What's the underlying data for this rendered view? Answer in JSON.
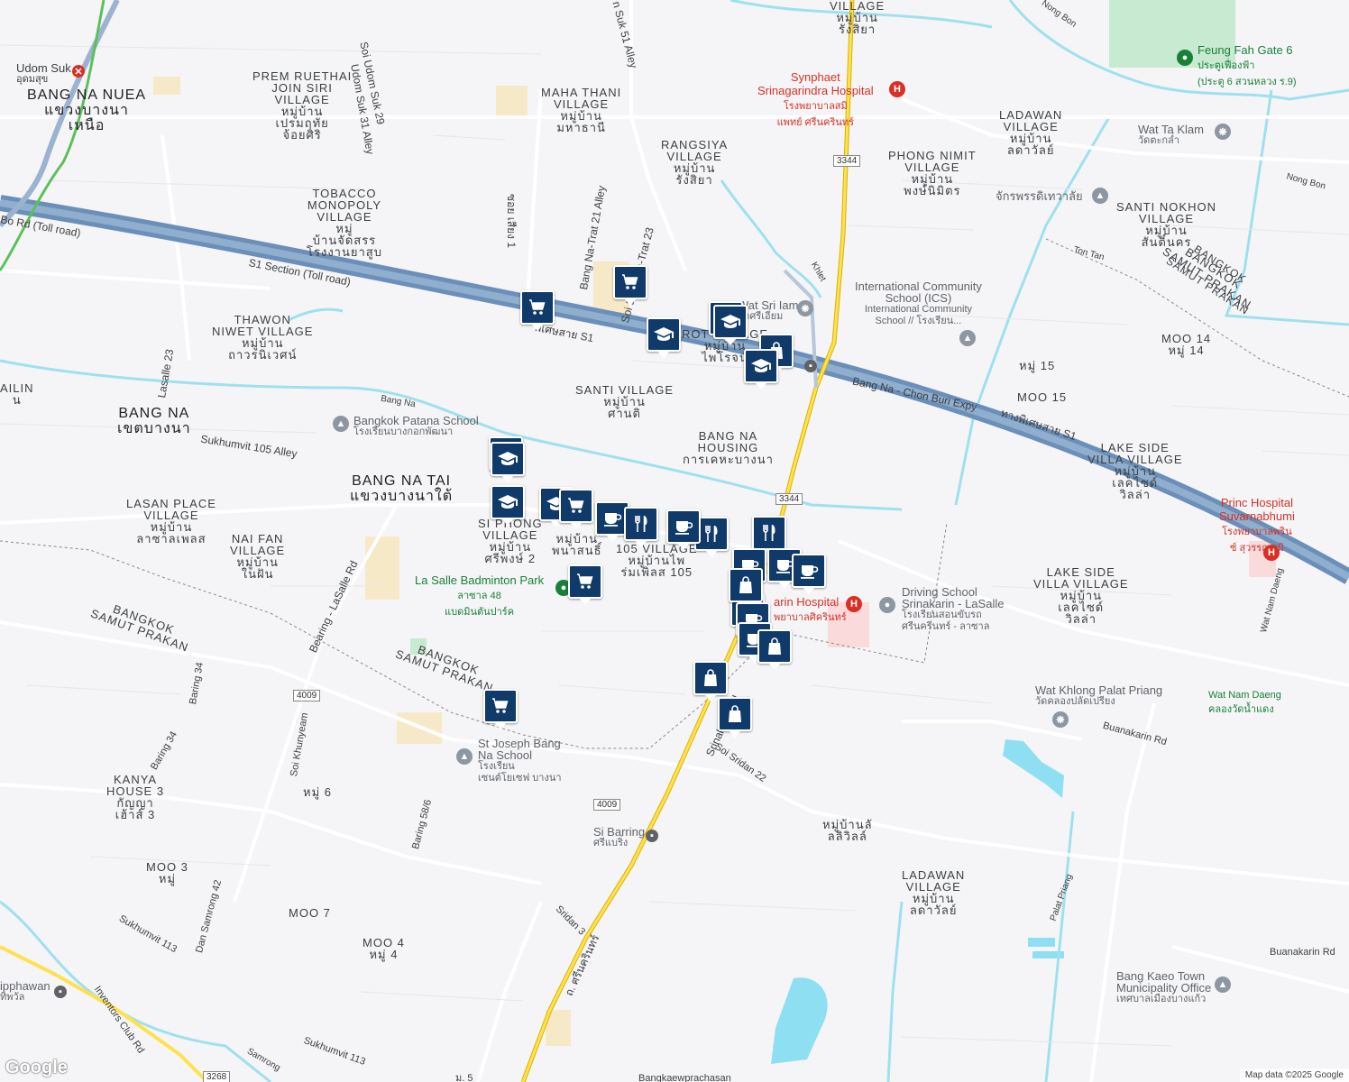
{
  "map": {
    "attribution": "Map data ©2025 Google",
    "logo": "Google",
    "districts": [
      {
        "name": "bang-na-nuea",
        "lines": [
          "BANG NA NUEA",
          "แขวงบางนา",
          "เหนือ"
        ]
      },
      {
        "name": "bang-na",
        "lines": [
          "BANG NA",
          "เขตบางนา"
        ]
      },
      {
        "name": "bang-na-tai",
        "lines": [
          "BANG NA TAI",
          "แขวงบางนาใต้"
        ]
      }
    ],
    "areas": [
      {
        "name": "prem-ruethai",
        "lines": [
          "PREM RUETHAI",
          "JOIN SIRI",
          "VILLAGE",
          "หมู่บ้าน",
          "เปรมฤทัย",
          "จ้อยศิริ"
        ]
      },
      {
        "name": "maha-thani",
        "lines": [
          "MAHA THANI",
          "VILLAGE",
          "หมู่บ้าน",
          "มหาธานี"
        ]
      },
      {
        "name": "rangsiya",
        "lines": [
          "RANGSIYA",
          "VILLAGE",
          "หมู่บ้าน",
          "รังสิยา"
        ]
      },
      {
        "name": "rangsiya-top",
        "lines": [
          "VILLAGE",
          "หมู่บ้าน",
          "รังสิยา"
        ]
      },
      {
        "name": "tobacco",
        "lines": [
          "TOBACCO",
          "MONOPOLY",
          "VILLAGE",
          "หมู่",
          "บ้านจัดสรร",
          "โรงงานยาสูบ"
        ]
      },
      {
        "name": "thawon",
        "lines": [
          "THAWON",
          "NIWET VILLAGE",
          "หมู่บ้าน",
          "ถาวรนิเวศน์"
        ]
      },
      {
        "name": "ladawan-1",
        "lines": [
          "LADAWAN",
          "VILLAGE",
          "หมู่บ้าน",
          "ลดาวัลย์"
        ]
      },
      {
        "name": "phong-nimit",
        "lines": [
          "PHONG NIMIT",
          "VILLAGE",
          "หมู่บ้าน",
          "พงษ์นิมิตร"
        ]
      },
      {
        "name": "santi-nokhon",
        "lines": [
          "SANTI NOKHON",
          "VILLAGE",
          "หมู่บ้าน",
          "สันติ์นคร"
        ]
      },
      {
        "name": "santi",
        "lines": [
          "SANTI VILLAGE",
          "หมู่บ้าน",
          "ศานติ"
        ]
      },
      {
        "name": "bang-na-housing",
        "lines": [
          "BANG NA",
          "HOUSING",
          "การเคหะบางนา"
        ]
      },
      {
        "name": "rot-village",
        "lines": [
          "ROT VILLAGE",
          "หมู่บ้าน",
          "ไพโรจน์"
        ]
      },
      {
        "name": "lasan-place",
        "lines": [
          "LASAN PLACE",
          "VILLAGE",
          "หมู่บ้าน",
          "ลาซาลเพลส"
        ]
      },
      {
        "name": "nai-fan",
        "lines": [
          "NAI FAN",
          "VILLAGE",
          "หมู่บ้าน",
          "ในฝัน"
        ]
      },
      {
        "name": "si-phong",
        "lines": [
          "SI PHONG",
          "VILLAGE",
          "หมู่บ้าน",
          "ศรีพงษ์ 2"
        ]
      },
      {
        "name": "phanasan",
        "lines": [
          "หมู่บ้าน",
          "พนาสนธิ์"
        ]
      },
      {
        "name": "village-105",
        "lines": [
          "105 VILLAGE",
          "หมู่บ้านไพ",
          "ร่มเพิ่ลส 105"
        ]
      },
      {
        "name": "lake-side-1",
        "lines": [
          "LAKE SIDE",
          "VILLA VILLAGE",
          "หมู่บ้าน",
          "เลคไซด์",
          "วิลล่า"
        ]
      },
      {
        "name": "lake-side-2",
        "lines": [
          "LAKE SIDE",
          "VILLA VILLAGE",
          "หมู่บ้าน",
          "เลคไซด์",
          "วิลล่า"
        ]
      },
      {
        "name": "kanya-house",
        "lines": [
          "KANYA",
          "HOUSE 3",
          "กัญญา",
          "เฮ้าส์ 3"
        ]
      },
      {
        "name": "ladawan-2",
        "lines": [
          "LADAWAN",
          "VILLAGE",
          "หมู่บ้าน",
          "ลดาวัลย์"
        ]
      },
      {
        "name": "lalil-villa",
        "lines": [
          "หมู่บ้านลั",
          "ลลิวิลล์"
        ]
      },
      {
        "name": "moo-14",
        "lines": [
          "MOO 14",
          "หมู่ 14"
        ]
      },
      {
        "name": "moo-15a",
        "lines": [
          "หมู่ 15"
        ]
      },
      {
        "name": "moo-15b",
        "lines": [
          "MOO 15"
        ]
      },
      {
        "name": "moo-6",
        "lines": [
          "หมู่ 6"
        ]
      },
      {
        "name": "moo-3",
        "lines": [
          "MOO 3",
          "หมู่"
        ]
      },
      {
        "name": "moo-7",
        "lines": [
          "MOO 7"
        ]
      },
      {
        "name": "moo-4",
        "lines": [
          "MOO 4",
          "หมู่ 4"
        ]
      },
      {
        "name": "bangkok-1",
        "lines": [
          "BANGKOK",
          "SAMUT PRAKAN"
        ]
      },
      {
        "name": "bangkok-2",
        "lines": [
          "BANGKOK",
          "SAMUT PRAKAN"
        ]
      },
      {
        "name": "bangkok-3",
        "lines": [
          "BANGKOK",
          "SAMUT PRAKAN"
        ]
      },
      {
        "name": "ailin",
        "lines": [
          "AILIN",
          "น"
        ]
      }
    ],
    "pois": [
      {
        "name": "udom-suk",
        "text": [
          "Udom Suk",
          "อุดมสุข"
        ],
        "style": "poi"
      },
      {
        "name": "synphaet",
        "text": [
          "Synphaet",
          "Srinagarindra Hospital",
          "โรงพยาบาลสมิ",
          "แพทย์ ศรีนครินทร์"
        ],
        "style": "poi-red"
      },
      {
        "name": "feung-fah",
        "text": [
          "Feung Fah Gate 6",
          "ประตูเฟื่องฟ้า",
          "(ประตู 6 สวนหลวง ร.9)"
        ],
        "style": "poi-green"
      },
      {
        "name": "wat-ta-klam",
        "text": [
          "Wat Ta Klam",
          "วัดตะกล่ำ"
        ],
        "style": "poi"
      },
      {
        "name": "chakkraphat",
        "text": [
          "จักรพรรดิเทวาลัย"
        ],
        "style": "poi"
      },
      {
        "name": "ics",
        "text": [
          "International Community",
          "School (ICS)",
          "International Community",
          "School // โรงเรียน..."
        ],
        "style": "poi"
      },
      {
        "name": "wat-sri-iam",
        "text": [
          "Wat Sri Iam",
          "วัดศรีเอี่ยม"
        ],
        "style": "poi"
      },
      {
        "name": "patana",
        "text": [
          "Bangkok Patana School",
          "โรงเรียนบางกอกพัฒนา"
        ],
        "style": "poi"
      },
      {
        "name": "la-salle-park",
        "text": [
          "La Salle Badminton Park",
          "ลาซาล 48",
          "แบดมินตันปาร์ค"
        ],
        "style": "poi-green"
      },
      {
        "name": "srinakarin-hospital",
        "text": [
          "arin Hospital",
          "พยาบาลศิครินทร์"
        ],
        "style": "poi-red"
      },
      {
        "name": "driving-school",
        "text": [
          "Driving School",
          "Srinakarin - LaSalle",
          "โรงเรียนสอนขับรถ",
          "ศรีนครินทร์ - ลาซาล"
        ],
        "style": "poi"
      },
      {
        "name": "princ-hospital",
        "text": [
          "Princ Hospital",
          "Suvarnabhumi",
          "โรงพยาบาลพริน",
          "ซ์ สุวรรณภูมิ"
        ],
        "style": "poi-red"
      },
      {
        "name": "wat-khlong",
        "text": [
          "Wat Khlong Palat Priang",
          "วัดคลองปลัดเปรียง"
        ],
        "style": "poi"
      },
      {
        "name": "wat-nam-daeng",
        "text": [
          "Wat Nam Daeng",
          "คลองวัดน้ำแดง"
        ],
        "style": "poi-green"
      },
      {
        "name": "st-joseph",
        "text": [
          "St Joseph Bang",
          "Na School",
          "โรงเรียน",
          "เซนต์โยเซฟ บางนา"
        ],
        "style": "poi"
      },
      {
        "name": "si-barring",
        "text": [
          "Si Barring",
          "ศรีแบริ่ง"
        ],
        "style": "poi"
      },
      {
        "name": "bang-kaeo",
        "text": [
          "Bang Kaeo Town",
          "Municipality Office",
          "เทศบาลเมืองบางแก้ว"
        ],
        "style": "poi"
      },
      {
        "name": "sipphawan",
        "text": [
          "ipphawan",
          "ทิพวัล"
        ],
        "style": "poi"
      }
    ],
    "roads": [
      {
        "name": "udom-suk-31",
        "text": "Udom Suk 31 Alley"
      },
      {
        "name": "soi-udom-suk-29",
        "text": "Soi Udom Suk 29"
      },
      {
        "name": "suk-51",
        "text": "n Suk 51 Alley"
      },
      {
        "name": "toll-road-1",
        "text": "Bo Rd (Toll road)"
      },
      {
        "name": "s1-section",
        "text": "S1 Section (Toll road)"
      },
      {
        "name": "s1-thai",
        "text": "พิเศษสาย S1"
      },
      {
        "name": "soi-lasalle-1",
        "text": "ซอย เสียง 1"
      },
      {
        "name": "bang-na-trat-21",
        "text": "Bang Na-Trat 21 Alley"
      },
      {
        "name": "soi-bangna-23",
        "text": "Soi Bang Na-Trat 23"
      },
      {
        "name": "lasalle-23",
        "text": "Lasalle 23"
      },
      {
        "name": "bang-na-canal",
        "text": "Bang Na"
      },
      {
        "name": "sukhumvit-105",
        "text": "Sukhumvit 105 Alley"
      },
      {
        "name": "bang-na-chon-buri",
        "text": "Bang Na - Chon Buri Expy"
      },
      {
        "name": "expy-thai",
        "text": "ทางพิเศษสาย S1"
      },
      {
        "name": "bearing-lasalle",
        "text": "Bearing - LaSalle Rd"
      },
      {
        "name": "baring-34a",
        "text": "Baring 34"
      },
      {
        "name": "baring-34b",
        "text": "Baring 34"
      },
      {
        "name": "soi-khunyeam",
        "text": "Soi Khunyeam"
      },
      {
        "name": "baring-58",
        "text": "Baring 58/6"
      },
      {
        "name": "srinakarin-rd",
        "text": "Srinakarin Rd"
      },
      {
        "name": "soi-sridan-22",
        "text": "Soi Sridan 22"
      },
      {
        "name": "sridan-3",
        "text": "Sridan 3"
      },
      {
        "name": "srinakarin-thai",
        "text": "ถ. ศรีนครินทร์"
      },
      {
        "name": "dan-samrong",
        "text": "Dan Samrong 42"
      },
      {
        "name": "sukhumvit-113a",
        "text": "Sukhumvit 113"
      },
      {
        "name": "sukhumvit-113b",
        "text": "Sukhumvit 113"
      },
      {
        "name": "inventors-club",
        "text": "Inventors Club Rd"
      },
      {
        "name": "samrong",
        "text": "Samrong"
      },
      {
        "name": "buanakarin-1",
        "text": "Buanakarin Rd"
      },
      {
        "name": "buanakarin-2",
        "text": "Buanakarin Rd"
      },
      {
        "name": "palat-priang",
        "text": "Palat Priang"
      },
      {
        "name": "nong-bon-1",
        "text": "Nong Bon"
      },
      {
        "name": "nong-bon-2",
        "text": "Nong Bon"
      },
      {
        "name": "ton-tan",
        "text": "Ton Tan"
      },
      {
        "name": "khlet",
        "text": "Khlet"
      },
      {
        "name": "wat-nam-daeng-rd",
        "text": "Wat Nam Daeng"
      },
      {
        "name": "bangkok-samut",
        "text": "BANGKOK"
      },
      {
        "name": "samut-prakan",
        "text": "SAMUT PRAKAN"
      },
      {
        "name": "moo-5",
        "text": "ม. 5"
      },
      {
        "name": "bangkaew",
        "text": "Bangkaewprachasan"
      }
    ],
    "badges": [
      {
        "name": "badge-3344-top",
        "text": "3344"
      },
      {
        "name": "badge-3344-mid",
        "text": "3344"
      },
      {
        "name": "badge-4009-a",
        "text": "4009"
      },
      {
        "name": "badge-4009-b",
        "text": "4009"
      },
      {
        "name": "badge-3268",
        "text": "3268"
      }
    ],
    "markers": [
      {
        "type": "cart"
      },
      {
        "type": "cart"
      },
      {
        "type": "cap"
      },
      {
        "type": "cap"
      },
      {
        "type": "cap"
      },
      {
        "type": "bag"
      },
      {
        "type": "cap"
      },
      {
        "type": "cap"
      },
      {
        "type": "cap"
      },
      {
        "type": "cap"
      },
      {
        "type": "cap"
      },
      {
        "type": "cart"
      },
      {
        "type": "cup"
      },
      {
        "type": "fork"
      },
      {
        "type": "fork"
      },
      {
        "type": "cup"
      },
      {
        "type": "fork"
      },
      {
        "type": "cup"
      },
      {
        "type": "cup"
      },
      {
        "type": "cup"
      },
      {
        "type": "cup"
      },
      {
        "type": "bag"
      },
      {
        "type": "cup"
      },
      {
        "type": "cup"
      },
      {
        "type": "bag"
      },
      {
        "type": "bag"
      },
      {
        "type": "bag"
      },
      {
        "type": "cart"
      },
      {
        "type": "cart"
      }
    ]
  }
}
